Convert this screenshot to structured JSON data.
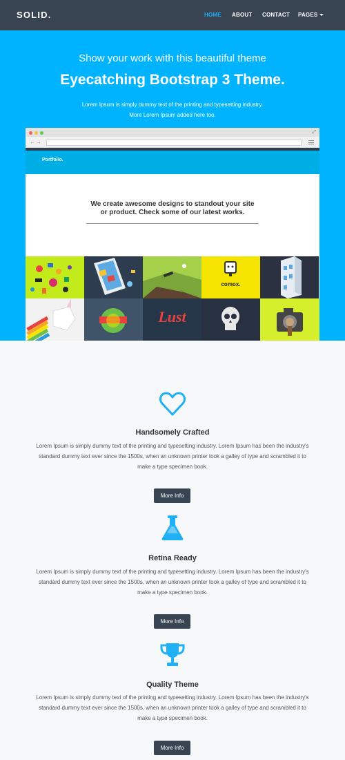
{
  "navbar": {
    "brand": "SOLID.",
    "links": [
      {
        "label": "HOME",
        "active": true
      },
      {
        "label": "ABOUT",
        "active": false
      },
      {
        "label": "CONTACT",
        "active": false
      },
      {
        "label": "PAGES",
        "active": false
      }
    ]
  },
  "hero": {
    "subtitle": "Show your work with this beautiful theme",
    "title": "Eyecatching Bootstrap 3 Theme.",
    "text_line1": "Lorem Ipsum is simply dummy text of the printing and typesetting industry.",
    "text_line2": "More Lorem Ipsum added here too."
  },
  "mockup": {
    "site_logo": "Portfolio.",
    "heading_line1": "We create awesome designs to standout your site",
    "heading_line2": "or product. Check some of our latest works.",
    "tiles": [
      {
        "name": "doodles-tile",
        "color": "#c3ea1b"
      },
      {
        "name": "tablet-tile",
        "color": "#2d3c4e"
      },
      {
        "name": "landscape-tile",
        "color": "#a4d04a"
      },
      {
        "name": "comox-tile",
        "color": "#f5e400",
        "label": "comox."
      },
      {
        "name": "building-tile",
        "color": "#2b3140"
      },
      {
        "name": "unicorn-tile",
        "color": "#f2f2f2"
      },
      {
        "name": "badge-tile",
        "color": "#3f5468"
      },
      {
        "name": "lust-tile",
        "color": "#253649",
        "label": "Lust"
      },
      {
        "name": "skull-tile",
        "color": "#283141"
      },
      {
        "name": "camera-tile",
        "color": "#d5ef2d"
      }
    ]
  },
  "features": [
    {
      "icon": "heart-icon",
      "title": "Handsomely Crafted",
      "text_line1": "Lorem Ipsum is simply dummy text of the printing and typesetting industry. Lorem Ipsum has been the industry's",
      "text_line2": "standard dummy text ever since the 1500s, when an unknown printer took a galley of type and scrambled it to",
      "text_line3": "make a type specimen book.",
      "button": "More Info"
    },
    {
      "icon": "flask-icon",
      "title": "Retina Ready",
      "text_line1": "Lorem Ipsum is simply dummy text of the printing and typesetting industry. Lorem Ipsum has been the industry's",
      "text_line2": "standard dummy text ever since the 1500s, when an unknown printer took a galley of type and scrambled it to",
      "text_line3": "make a type specimen book.",
      "button": "More Info"
    },
    {
      "icon": "trophy-icon",
      "title": "Quality Theme",
      "text_line1": "Lorem Ipsum is simply dummy text of the printing and typesetting industry. Lorem Ipsum has been the industry's",
      "text_line2": "standard dummy text ever since the 1500s, when an unknown printer took a galley of type and scrambled it to",
      "text_line3": "make a type specimen book.",
      "button": "More Info"
    }
  ],
  "colors": {
    "navbar_bg": "#384452",
    "accent": "#1fb0f5",
    "hero_bg": "#00b3fe",
    "button_bg": "#384452"
  }
}
